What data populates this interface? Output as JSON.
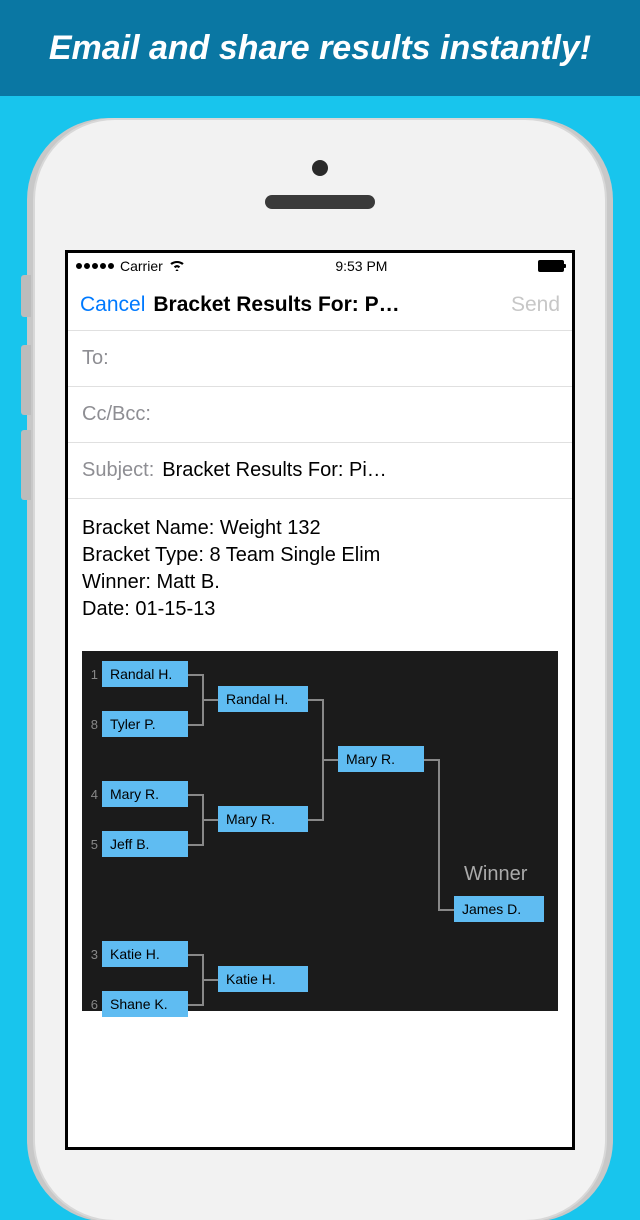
{
  "banner": {
    "headline": "Email and share results instantly!"
  },
  "status": {
    "carrier": "Carrier",
    "time": "9:53 PM"
  },
  "nav": {
    "cancel": "Cancel",
    "title": "Bracket Results For: P…",
    "send": "Send"
  },
  "compose": {
    "to_label": "To:",
    "cc_label": "Cc/Bcc:",
    "subject_label": "Subject:",
    "subject_value": "Bracket Results For: Pi…"
  },
  "body": {
    "line1": "Bracket Name: Weight 132",
    "line2": "Bracket Type: 8 Team Single Elim",
    "line3": "Winner: Matt B.",
    "line4": "Date: 01-15-13"
  },
  "bracket": {
    "seeds": [
      "1",
      "8",
      "4",
      "5",
      "3",
      "6"
    ],
    "r1": [
      "Randal H.",
      "Tyler P.",
      "Mary R.",
      "Jeff B.",
      "Katie H.",
      "Shane K."
    ],
    "r2": [
      "Randal H.",
      "Mary R.",
      "Katie H."
    ],
    "r3": [
      "Mary R."
    ],
    "winner_label": "Winner",
    "winner": "James D."
  }
}
